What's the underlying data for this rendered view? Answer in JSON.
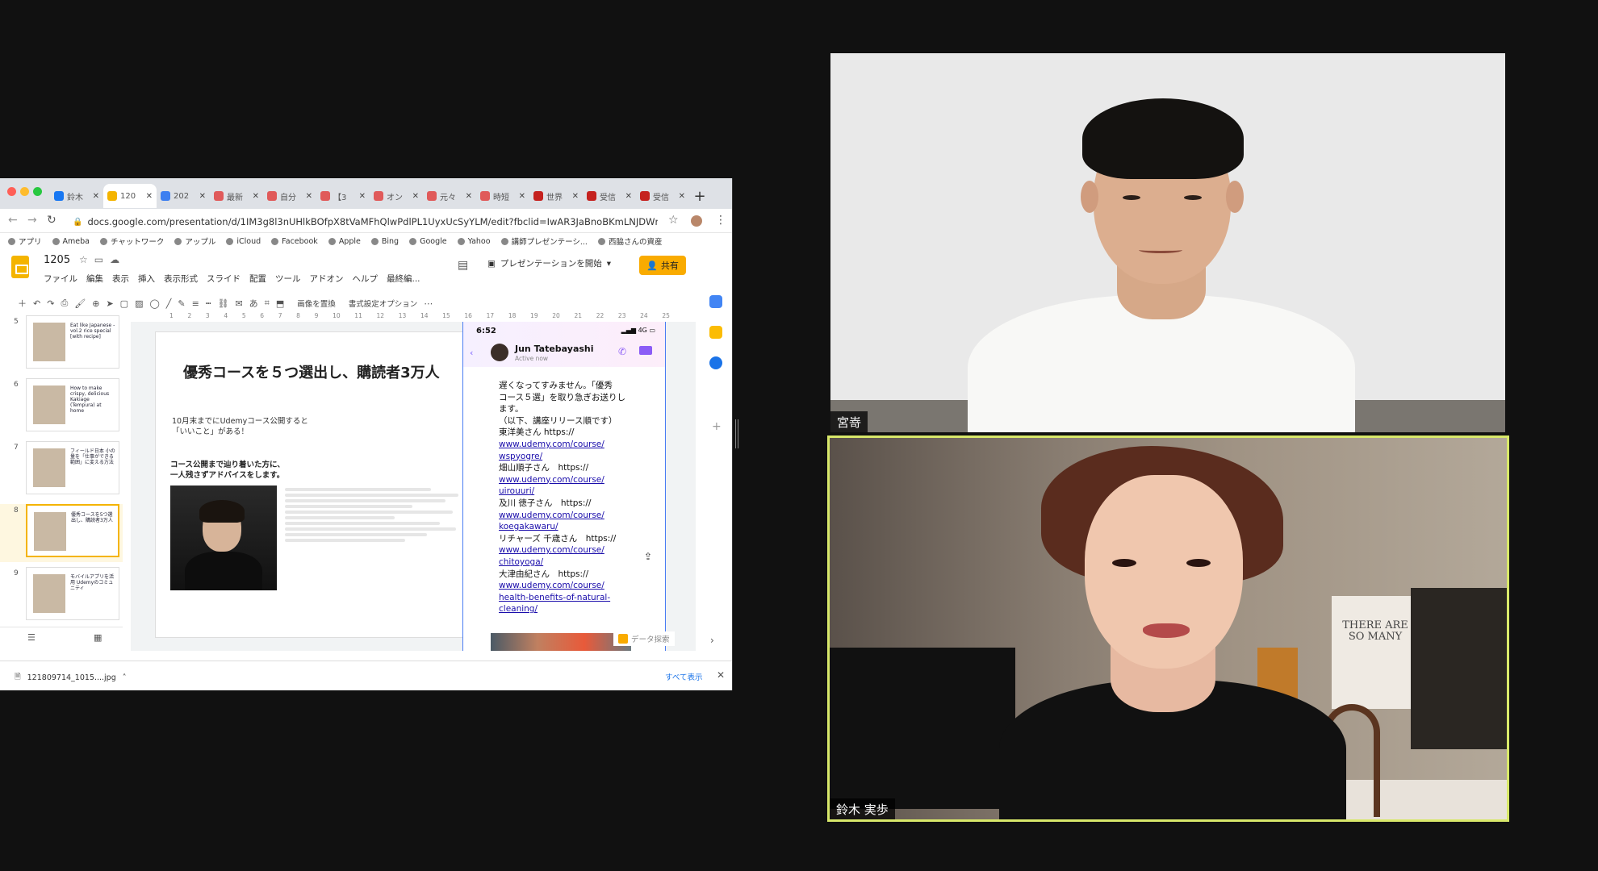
{
  "browser": {
    "tabs": [
      {
        "title": "鈴木",
        "color": "#1877f2"
      },
      {
        "title": "120",
        "color": "#f4b400",
        "active": true
      },
      {
        "title": "202",
        "color": "#3d7ff0"
      },
      {
        "title": "最新",
        "color": "#e05a5a"
      },
      {
        "title": "自分",
        "color": "#e05a5a"
      },
      {
        "title": "【3",
        "color": "#e05a5a"
      },
      {
        "title": "オン",
        "color": "#e05a5a"
      },
      {
        "title": "元々",
        "color": "#e05a5a"
      },
      {
        "title": "時短",
        "color": "#e05a5a"
      },
      {
        "title": "世界",
        "color": "#c5221f"
      },
      {
        "title": "受信",
        "color": "#c5221f"
      },
      {
        "title": "受信",
        "color": "#c5221f"
      }
    ],
    "url": "docs.google.com/presentation/d/1IM3g8l3nUHlkBOfpX8tVaMFhQlwPdlPL1UyxUcSyYLM/edit?fbclid=IwAR3JaBnoBKmLNJDWmY9Gpqobq...",
    "bookmarks": [
      "アプリ",
      "Ameba",
      "チャットワーク",
      "アップル",
      "iCloud",
      "Facebook",
      "Apple",
      "Bing",
      "Google",
      "Yahoo",
      "講師プレゼンテーシ...",
      "西脇さんの資産"
    ]
  },
  "slides_app": {
    "doc_title": "1205",
    "menus": [
      "ファイル",
      "編集",
      "表示",
      "挿入",
      "表示形式",
      "スライド",
      "配置",
      "ツール",
      "アドオン",
      "ヘルプ",
      "最終編..."
    ],
    "present_label": "プレゼンテーションを開始",
    "share_label": "共有",
    "toolbar_replace": "画像を置換",
    "toolbar_format": "書式設定オプション",
    "ruler": [
      "1",
      "2",
      "3",
      "4",
      "5",
      "6",
      "7",
      "8",
      "9",
      "10",
      "11",
      "12",
      "13",
      "14",
      "15",
      "16",
      "17",
      "18",
      "19",
      "20",
      "21",
      "22",
      "23",
      "24",
      "25"
    ],
    "thumbnails": [
      {
        "num": "5",
        "text": "Eat like Japanese -vol.2 rice special [with recipe]"
      },
      {
        "num": "6",
        "text": "How to make crispy, delicious Kakiage (Tempura) at home"
      },
      {
        "num": "7",
        "text": "フィールド日本 小の量を「仕事ができる範囲」に変える方法"
      },
      {
        "num": "8",
        "text": "優秀コースを5つ選出し、購読者3万人",
        "selected": true
      },
      {
        "num": "9",
        "text": "モバイルアプリを活用 Udemyのコミュニティ"
      }
    ],
    "slide": {
      "title": "優秀コースを５つ選出し、購読者3万人",
      "sub1_line1": "10月末までにUdemyコース公開すると",
      "sub1_line2": "「いいこと」がある！",
      "sub2_line1": "コース公開まで辿り着いた方に、",
      "sub2_line2": "一人残さずアドバイスをします。"
    },
    "download_file": "121809714_1015....jpg",
    "download_show_all": "すべて表示"
  },
  "phone": {
    "time": "6:52",
    "network": "4G",
    "contact_name": "Jun Tatebayashi",
    "contact_status": "Active now",
    "message_lines": [
      {
        "t": "遅くなってすみません。「優秀",
        "link": false
      },
      {
        "t": "コース５選」を取り急ぎお送りし",
        "link": false
      },
      {
        "t": "ます。",
        "link": false
      },
      {
        "t": "（以下、講座リリース順です）",
        "link": false
      },
      {
        "t": "東洋美さん https://",
        "link": false
      },
      {
        "t": "www.udemy.com/course/",
        "link": true
      },
      {
        "t": "wspyogre/",
        "link": true
      },
      {
        "t": "畑山順子さん　https://",
        "link": false
      },
      {
        "t": "www.udemy.com/course/",
        "link": true
      },
      {
        "t": "uirouuri/",
        "link": true
      },
      {
        "t": "及川 徳子さん　https://",
        "link": false
      },
      {
        "t": "www.udemy.com/course/",
        "link": true
      },
      {
        "t": "koegakawaru/",
        "link": true
      },
      {
        "t": "リチャーズ 千歳さん　https://",
        "link": false
      },
      {
        "t": "www.udemy.com/course/",
        "link": true
      },
      {
        "t": "chitoyoga/",
        "link": true
      },
      {
        "t": "大津由紀さん　https://",
        "link": false
      },
      {
        "t": "www.udemy.com/course/",
        "link": true
      },
      {
        "t": "health-benefits-of-natural-",
        "link": true
      },
      {
        "t": "cleaning/",
        "link": true
      }
    ],
    "explore_label": "データ探索"
  },
  "participants": [
    {
      "name": "宮嵜"
    },
    {
      "name": "鈴木 実歩",
      "active_speaker": true
    }
  ],
  "poster_text": "THERE ARE SO MANY",
  "colors": {
    "active_speaker_border": "#d8e86a",
    "slides_yellow": "#f4b400",
    "share_button": "#f9ab00"
  }
}
